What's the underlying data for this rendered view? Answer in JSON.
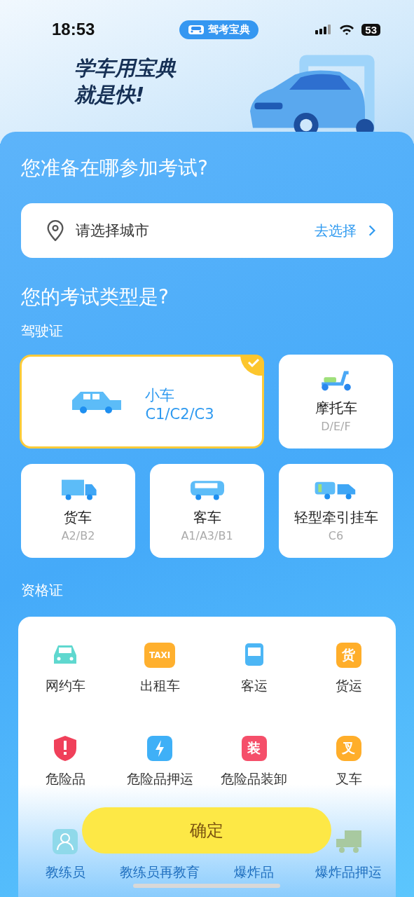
{
  "status_bar": {
    "time": "18:53",
    "app_pill": "驾考宝典",
    "battery": "53"
  },
  "hero": {
    "lines": [
      "学车用宝典",
      "就是快!"
    ]
  },
  "location": {
    "title": "您准备在哪参加考试?",
    "placeholder": "请选择城市",
    "action": "去选择"
  },
  "exam": {
    "title": "您的考试类型是?",
    "section_label": "驾驶证",
    "vehicles": [
      {
        "kind": "car",
        "name": "小车",
        "codes": "C1/C2/C3",
        "selected": true
      },
      {
        "kind": "motorcycle",
        "name": "摩托车",
        "codes": "D/E/F",
        "selected": false
      },
      {
        "kind": "truck",
        "name": "货车",
        "codes": "A2/B2",
        "selected": false
      },
      {
        "kind": "bus",
        "name": "客车",
        "codes": "A1/A3/B1",
        "selected": false
      },
      {
        "kind": "trailer",
        "name": "轻型牵引挂车",
        "codes": "C6",
        "selected": false
      }
    ]
  },
  "qualification": {
    "section_label": "资格证",
    "items": [
      {
        "kind": "car",
        "label": "网约车",
        "color": "#5fd8cf",
        "dimmed": false
      },
      {
        "kind": "badge",
        "badge": "TAXI",
        "label": "出租车",
        "color": "#ffb02e",
        "dimmed": false
      },
      {
        "kind": "bus",
        "label": "客运",
        "color": "#4cb6f5",
        "dimmed": false
      },
      {
        "kind": "badge",
        "badge": "货",
        "label": "货运",
        "color": "#ffae2a",
        "dimmed": false
      },
      {
        "kind": "shield",
        "label": "危险品",
        "color": "#f0405a",
        "dimmed": false
      },
      {
        "kind": "bolt",
        "label": "危险品押运",
        "color": "#3fb0f7",
        "dimmed": false
      },
      {
        "kind": "badge",
        "badge": "装",
        "label": "危险品装卸",
        "color": "#f54f6a",
        "dimmed": false
      },
      {
        "kind": "hex",
        "badge": "叉",
        "label": "叉车",
        "color": "#ffae2a",
        "dimmed": false
      },
      {
        "kind": "person",
        "label": "教练员",
        "color": "#8fd9ea",
        "dimmed": true
      },
      {
        "kind": "covered",
        "label": "教练员再教育",
        "dimmed": true
      },
      {
        "kind": "covered",
        "label": "爆炸品",
        "dimmed": true
      },
      {
        "kind": "explosive-truck",
        "label": "爆炸品押运",
        "color": "#a8c9a0",
        "dimmed": true
      }
    ]
  },
  "confirm_button": "确定"
}
